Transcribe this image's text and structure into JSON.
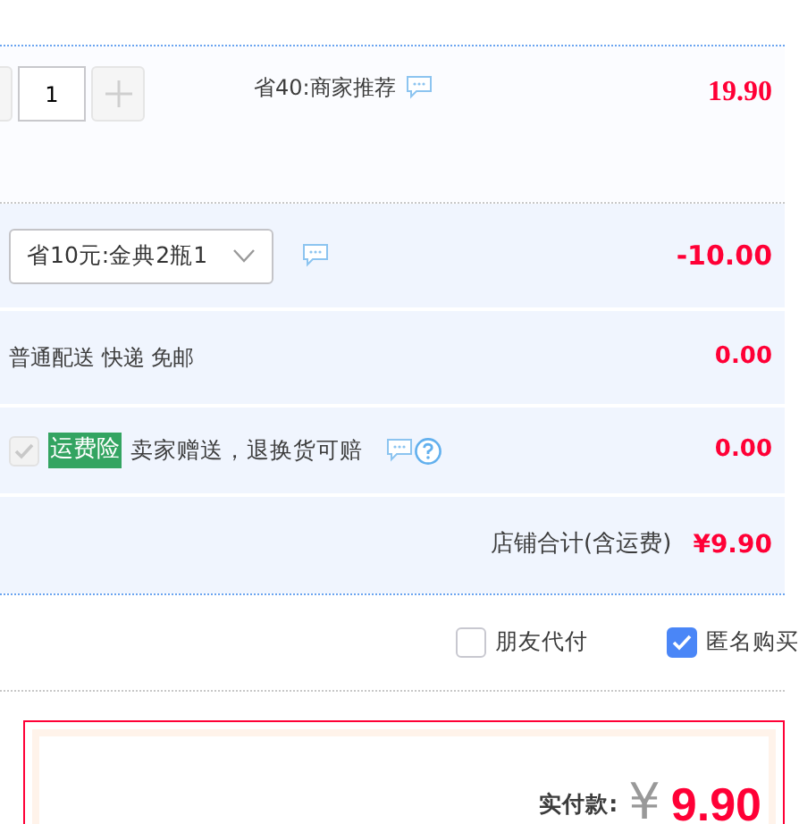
{
  "item": {
    "quantity": "1",
    "note": "省40:商家推荐",
    "price": "19.90"
  },
  "promotion": {
    "value": "省10元:金典2瓶1",
    "amount": "-10.00"
  },
  "shipping": {
    "label": "普通配送 快递 免邮",
    "amount": "0.00"
  },
  "insurance": {
    "checked": true,
    "disabled": true,
    "tag": "运费险",
    "label": "卖家赠送，退换货可赔",
    "amount": "0.00"
  },
  "shop_total": {
    "label": "店铺合计(含运费)",
    "amount": "¥9.90"
  },
  "options": [
    {
      "label": "朋友代付",
      "checked": false
    },
    {
      "label": "匿名购买",
      "checked": true
    }
  ],
  "payment": {
    "label": "实付款:",
    "currency": "¥",
    "amount": "9.90"
  }
}
